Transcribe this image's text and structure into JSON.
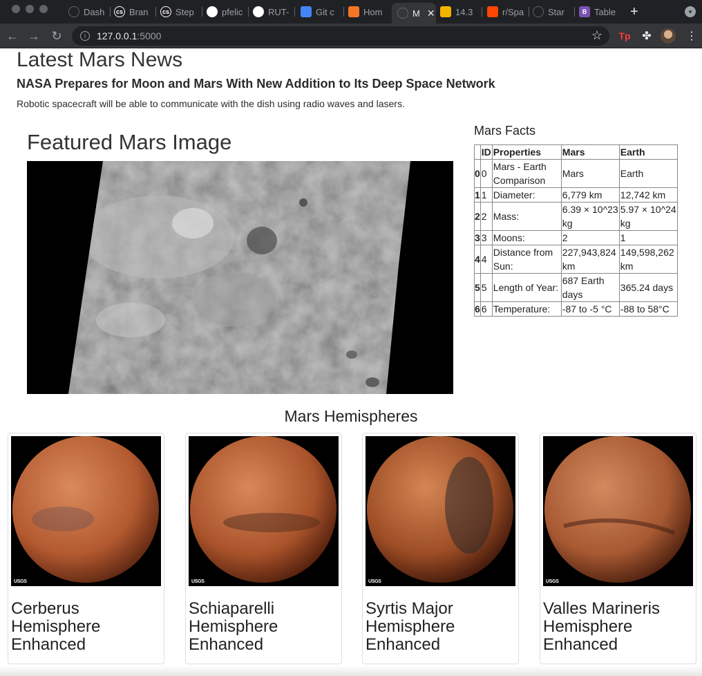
{
  "browser": {
    "tabs": [
      {
        "label": "Dash",
        "icon": "globe-icon",
        "color": "#5f6368"
      },
      {
        "label": "Bran",
        "icon": "cs-icon",
        "color": "#ffffff"
      },
      {
        "label": "Step",
        "icon": "cs-icon",
        "color": "#ffffff"
      },
      {
        "label": "pfelic",
        "icon": "github-icon",
        "color": "#ffffff"
      },
      {
        "label": "RUT-",
        "icon": "github-icon",
        "color": "#ffffff"
      },
      {
        "label": "Git c",
        "icon": "docs-icon",
        "color": "#4285f4"
      },
      {
        "label": "Hom",
        "icon": "jupyter-icon",
        "color": "#f37626"
      },
      {
        "label": "M",
        "icon": "globe-icon",
        "color": "#5f6368"
      },
      {
        "label": "14.3",
        "icon": "slides-icon",
        "color": "#f4b400"
      },
      {
        "label": "r/Spa",
        "icon": "reddit-icon",
        "color": "#ff4500"
      },
      {
        "label": "Star",
        "icon": "globe-icon",
        "color": "#5f6368"
      },
      {
        "label": "Table",
        "icon": "bootstrap-icon",
        "color": "#7952b3"
      }
    ],
    "active_tab": 7,
    "url_host": "127.0.0.1",
    "url_port": ":5000",
    "ext_tp": "Tp"
  },
  "news": {
    "section_title": "Latest Mars News",
    "headline": "NASA Prepares for Moon and Mars With New Addition to Its Deep Space Network",
    "teaser": "Robotic spacecraft will be able to communicate with the dish using radio waves and lasers."
  },
  "featured": {
    "title": "Featured Mars Image"
  },
  "facts": {
    "title": "Mars Facts",
    "headers": [
      "ID",
      "Properties",
      "Mars",
      "Earth"
    ],
    "rows": [
      {
        "index": "0",
        "id": "0",
        "property": "Mars - Earth Comparison",
        "mars": "Mars",
        "earth": "Earth"
      },
      {
        "index": "1",
        "id": "1",
        "property": "Diameter:",
        "mars": "6,779 km",
        "earth": "12,742 km"
      },
      {
        "index": "2",
        "id": "2",
        "property": "Mass:",
        "mars": "6.39 × 10^23 kg",
        "earth": "5.97 × 10^24 kg"
      },
      {
        "index": "3",
        "id": "3",
        "property": "Moons:",
        "mars": "2",
        "earth": "1"
      },
      {
        "index": "4",
        "id": "4",
        "property": "Distance from Sun:",
        "mars": "227,943,824 km",
        "earth": "149,598,262 km"
      },
      {
        "index": "5",
        "id": "5",
        "property": "Length of Year:",
        "mars": "687 Earth days",
        "earth": "365.24 days"
      },
      {
        "index": "6",
        "id": "6",
        "property": "Temperature:",
        "mars": "-87 to -5 °C",
        "earth": "-88 to 58°C"
      }
    ]
  },
  "hemispheres": {
    "title": "Mars Hemispheres",
    "usgs_label": "USGS",
    "items": [
      {
        "name": "Cerberus Hemisphere Enhanced"
      },
      {
        "name": "Schiaparelli Hemisphere Enhanced"
      },
      {
        "name": "Syrtis Major Hemisphere Enhanced"
      },
      {
        "name": "Valles Marineris Hemisphere Enhanced"
      }
    ]
  }
}
